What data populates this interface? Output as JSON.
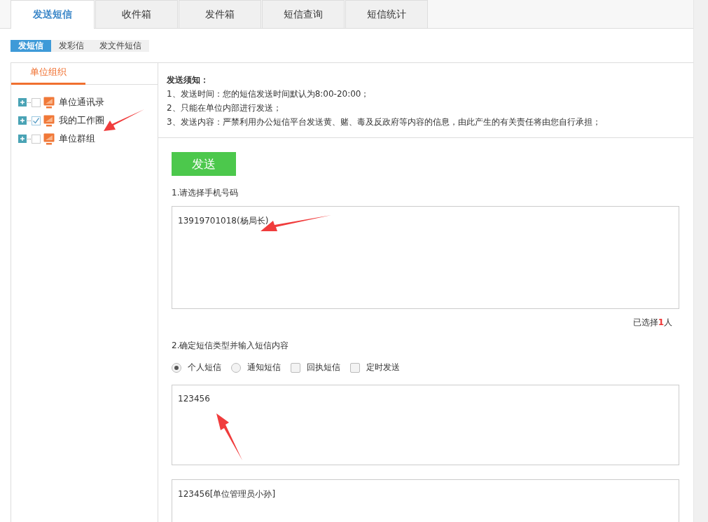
{
  "tabs": [
    {
      "label": "发送短信",
      "selected": true
    },
    {
      "label": "收件箱",
      "selected": false
    },
    {
      "label": "发件箱",
      "selected": false
    },
    {
      "label": "短信查询",
      "selected": false
    },
    {
      "label": "短信统计",
      "selected": false
    }
  ],
  "subtabs": [
    {
      "label": "发短信",
      "selected": true
    },
    {
      "label": "发彩信",
      "selected": false
    },
    {
      "label": "发文件短信",
      "selected": false
    }
  ],
  "sidebar": {
    "tab": "单位组织",
    "tree": [
      {
        "label": "单位通讯录",
        "checked": false,
        "expanded": false
      },
      {
        "label": "我的工作圈",
        "checked": true,
        "expanded": false
      },
      {
        "label": "单位群组",
        "checked": false,
        "expanded": false
      }
    ]
  },
  "notice": {
    "title": "发送须知：",
    "lines": [
      "1、发送时间：您的短信发送时间默认为8:00-20:00；",
      "2、只能在单位内部进行发送；",
      "3、发送内容：严禁利用办公短信平台发送黄、赌、毒及反政府等内容的信息，由此产生的有关责任将由您自行承担；"
    ]
  },
  "send_button": "发送",
  "step1": {
    "label": "1.请选择手机号码",
    "value": "13919701018(杨局长)",
    "count_prefix": "已选择",
    "count": "1",
    "count_suffix": "人"
  },
  "step2": {
    "label": "2.确定短信类型并输入短信内容",
    "options": [
      {
        "kind": "radio",
        "label": "个人短信",
        "selected": true
      },
      {
        "kind": "radio",
        "label": "通知短信",
        "selected": false
      },
      {
        "kind": "checkbox",
        "label": "回执短信",
        "checked": false
      },
      {
        "kind": "checkbox",
        "label": "定时发送",
        "checked": false
      }
    ],
    "content": "123456",
    "preview": "123456[单位管理员小孙]"
  }
}
